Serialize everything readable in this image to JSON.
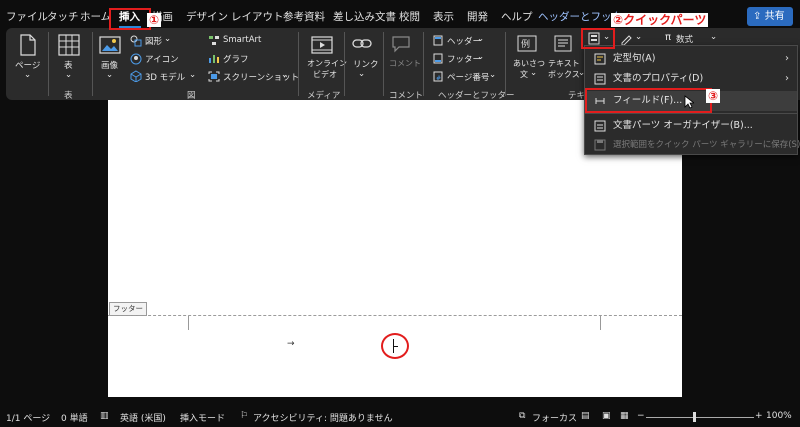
{
  "tabs": [
    {
      "label": "ファイル"
    },
    {
      "label": "タッチ"
    },
    {
      "label": "ホーム"
    },
    {
      "label": "挿入"
    },
    {
      "label": "描画"
    },
    {
      "label": "デザイン"
    },
    {
      "label": "レイアウト"
    },
    {
      "label": "参考資料"
    },
    {
      "label": "差し込み文書"
    },
    {
      "label": "校閲"
    },
    {
      "label": "表示"
    },
    {
      "label": "開発"
    },
    {
      "label": "ヘルプ"
    },
    {
      "label": "ヘッダーとフッター"
    }
  ],
  "share_label": "共有",
  "annotations": {
    "step1": "①",
    "step2": "②クイックパーツ",
    "step3": "③"
  },
  "ribbon": {
    "page": "ページ",
    "table": "表",
    "image": "画像",
    "shapes": "図形",
    "icons": "アイコン",
    "models3d": "3D モデル",
    "smartart": "SmartArt",
    "graph": "グラフ",
    "screenshot": "スクリーンショット",
    "online_video_1": "オンライン",
    "online_video_2": "ビデオ",
    "link": "リンク",
    "comment": "コメント",
    "header": "ヘッダー",
    "footer": "フッター",
    "page_number": "ページ番号",
    "greeting_1": "あいさつ",
    "greeting_2": "文",
    "textbox_1": "テキスト",
    "textbox_2": "ボックス",
    "formula": "数式",
    "example_icon": "例",
    "groups": {
      "table": "表",
      "figure": "図",
      "media": "メディア",
      "comment": "コメント",
      "header_footer": "ヘッダーとフッター",
      "text": "テキ"
    }
  },
  "menu": {
    "items": [
      {
        "label": "定型句(A)",
        "submenu": true
      },
      {
        "label": "文書のプロパティ(D)",
        "submenu": true
      },
      {
        "label": "フィールド(F)...",
        "submenu": false
      },
      {
        "label": "文書パーツ オーガナイザー(B)...",
        "submenu": false
      },
      {
        "label": "選択範囲をクイック パーツ ギャラリーに保存(S)...",
        "submenu": false
      }
    ]
  },
  "document": {
    "footer_tag": "フッター",
    "tab_mark": "→"
  },
  "status": {
    "page": "1/1 ページ",
    "words": "0 単語",
    "language": "英語 (米国)",
    "mode": "挿入モード",
    "accessibility": "アクセシビリティ: 問題ありません",
    "focus": "フォーカス",
    "zoom": "100%",
    "zoom_minus": "−",
    "zoom_plus": "+"
  },
  "colors": {
    "accent": "#2b88d8",
    "annotation": "#e21d1d"
  }
}
